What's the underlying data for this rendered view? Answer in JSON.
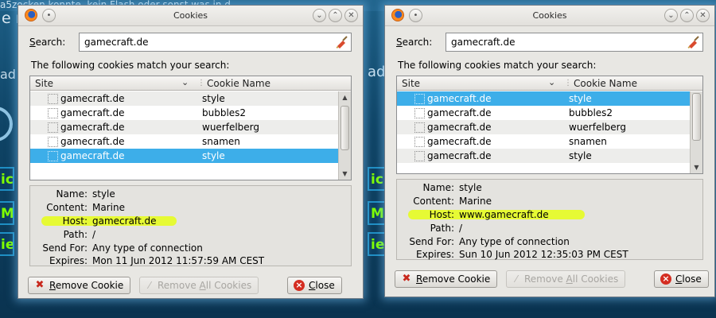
{
  "background": {
    "top_text": "a5zocken konnte, kein Flash oder sonst was in d",
    "fragment_e": "e r",
    "fragment_ad": "ad",
    "tile_c": "ic",
    "tile_m": "M",
    "tile_ie": "ie"
  },
  "windows": [
    {
      "title": "Cookies",
      "search_label": "Search:",
      "search_accel": "S",
      "search_rest": "earch:",
      "search_value": "gamecraft.de",
      "match_text": "The following cookies match your search:",
      "columns": {
        "site": "Site",
        "cookie_name": "Cookie Name"
      },
      "rows": [
        {
          "site": "gamecraft.de",
          "cookie": "style",
          "selected": false
        },
        {
          "site": "gamecraft.de",
          "cookie": "bubbles2",
          "selected": false
        },
        {
          "site": "gamecraft.de",
          "cookie": "wuerfelberg",
          "selected": false
        },
        {
          "site": "gamecraft.de",
          "cookie": "snamen",
          "selected": false
        },
        {
          "site": "gamecraft.de",
          "cookie": "style",
          "selected": true
        }
      ],
      "details": {
        "name_label": "Name:",
        "name": "style",
        "content_label": "Content:",
        "content": "Marine",
        "host_label": "Host:",
        "host": "gamecraft.de",
        "path_label": "Path:",
        "path": "/",
        "sendfor_label": "Send For:",
        "sendfor": "Any type of connection",
        "expires_label": "Expires:",
        "expires": "Mon 11 Jun 2012 11:57:59 AM CEST"
      },
      "buttons": {
        "remove_accel": "R",
        "remove_rest": "emove Cookie",
        "remove_all_a": "Remove ",
        "remove_all_accel": "A",
        "remove_all_rest": "ll Cookies",
        "close_accel": "C",
        "close_rest": "lose"
      }
    },
    {
      "title": "Cookies",
      "search_label": "Search:",
      "search_accel": "S",
      "search_rest": "earch:",
      "search_value": "gamecraft.de",
      "match_text": "The following cookies match your search:",
      "columns": {
        "site": "Site",
        "cookie_name": "Cookie Name"
      },
      "rows": [
        {
          "site": "gamecraft.de",
          "cookie": "style",
          "selected": true
        },
        {
          "site": "gamecraft.de",
          "cookie": "bubbles2",
          "selected": false
        },
        {
          "site": "gamecraft.de",
          "cookie": "wuerfelberg",
          "selected": false
        },
        {
          "site": "gamecraft.de",
          "cookie": "snamen",
          "selected": false
        },
        {
          "site": "gamecraft.de",
          "cookie": "style",
          "selected": false
        }
      ],
      "details": {
        "name_label": "Name:",
        "name": "style",
        "content_label": "Content:",
        "content": "Marine",
        "host_label": "Host:",
        "host": "www.gamecraft.de",
        "path_label": "Path:",
        "path": "/",
        "sendfor_label": "Send For:",
        "sendfor": "Any type of connection",
        "expires_label": "Expires:",
        "expires": "Sun 10 Jun 2012 12:35:03 PM CEST"
      },
      "buttons": {
        "remove_accel": "R",
        "remove_rest": "emove Cookie",
        "remove_all_a": "Remove ",
        "remove_all_accel": "A",
        "remove_all_rest": "ll Cookies",
        "close_accel": "C",
        "close_rest": "lose"
      }
    }
  ],
  "colors": {
    "selection": "#3daee9",
    "highlight": "#e6fb2a",
    "window_bg": "#e8e7e3"
  },
  "icons": {
    "app": "firefox-icon",
    "clear": "clear-search-icon",
    "remove": "remove-icon",
    "close": "close-icon"
  }
}
